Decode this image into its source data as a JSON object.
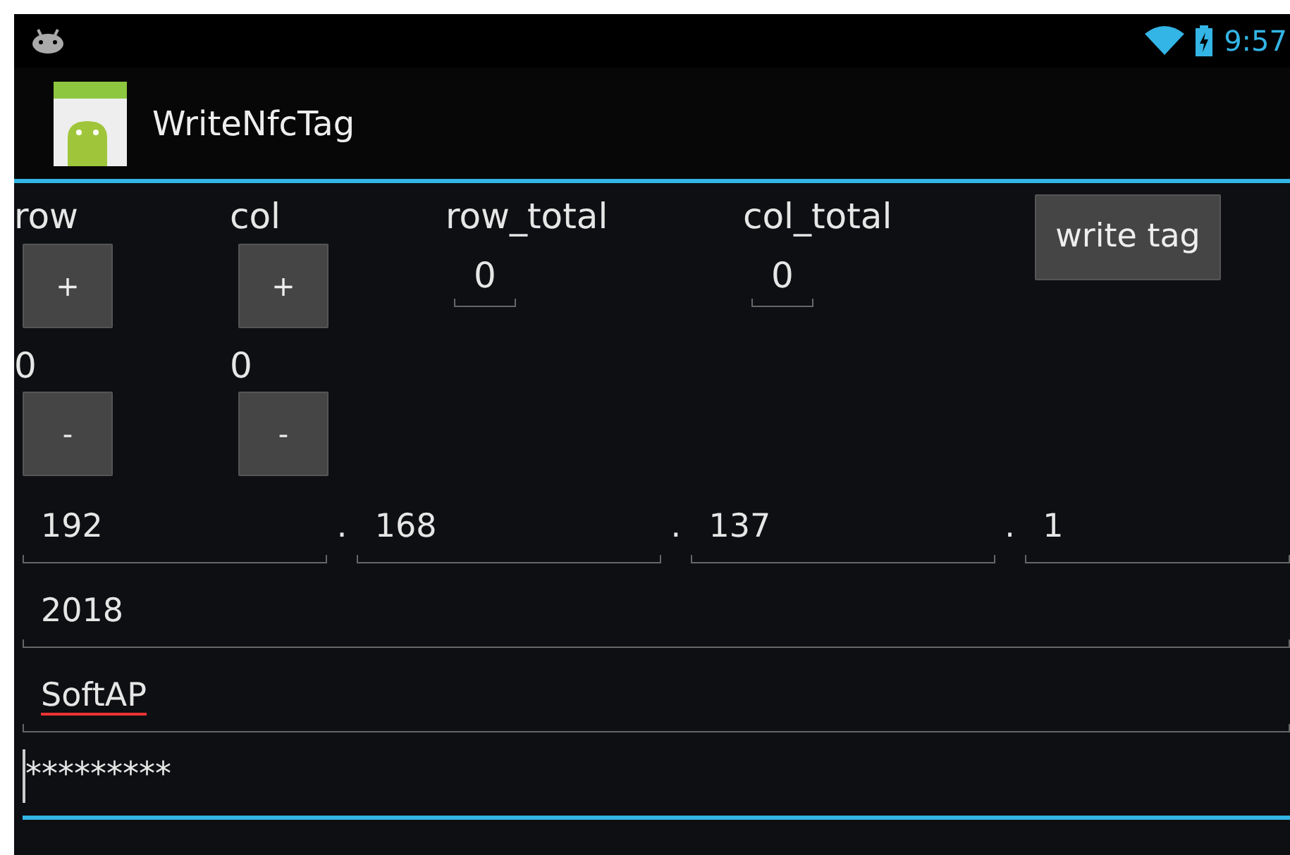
{
  "status_bar": {
    "time": "9:57"
  },
  "action_bar": {
    "title": "WriteNfcTag"
  },
  "counters": [
    {
      "label": "row",
      "value": "0",
      "plus": "+",
      "minus": "-"
    },
    {
      "label": "col",
      "value": "0",
      "plus": "+",
      "minus": "-"
    }
  ],
  "totals": [
    {
      "label": "row_total",
      "value": "0"
    },
    {
      "label": "col_total",
      "value": "0"
    }
  ],
  "write_button": "write tag",
  "ip_address": [
    {
      "value": "192"
    },
    {
      "separator": ".",
      "value": "168"
    },
    {
      "separator": ".",
      "value": "137"
    },
    {
      "separator": ".",
      "value": "1"
    }
  ],
  "fields": [
    {
      "value": "2018",
      "misspelled": false,
      "focused": false
    },
    {
      "value": "SoftAP",
      "misspelled": true,
      "focused": false
    },
    {
      "value": "*********",
      "misspelled": false,
      "focused": true
    }
  ]
}
